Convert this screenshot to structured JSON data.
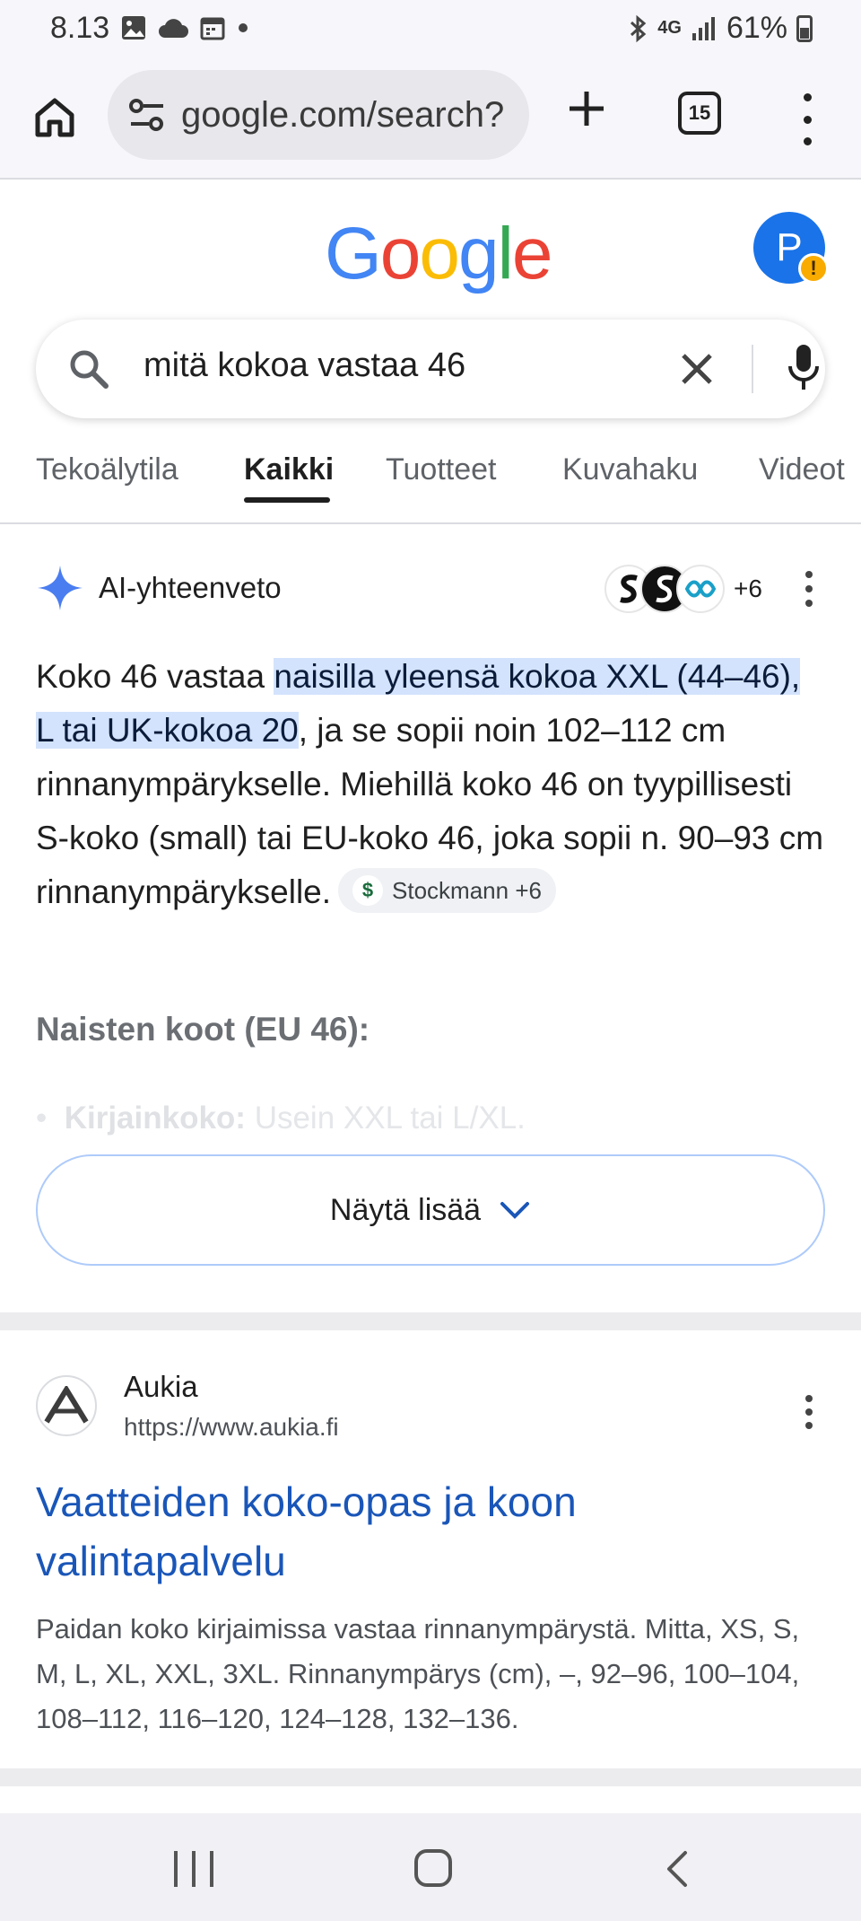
{
  "status_bar": {
    "time": "8.13",
    "network": "4G",
    "battery": "61%",
    "icons": [
      "image-icon",
      "cloud-icon",
      "calendar-icon",
      "dot-icon",
      "bluetooth-icon",
      "signal-icon",
      "battery-icon"
    ]
  },
  "browser": {
    "url": "google.com/search?",
    "tab_count": "15"
  },
  "google": {
    "logo_text": [
      "G",
      "o",
      "o",
      "g",
      "l",
      "e"
    ],
    "logo_colors": [
      "#4285F4",
      "#EA4335",
      "#FBBC05",
      "#4285F4",
      "#34A853",
      "#EA4335"
    ],
    "avatar_letter": "P",
    "avatar_badge": "!"
  },
  "search": {
    "query": "mitä kokoa vastaa 46"
  },
  "tabs": [
    {
      "label": "Tekoälytila",
      "active": false
    },
    {
      "label": "Kaikki",
      "active": true
    },
    {
      "label": "Tuotteet",
      "active": false
    },
    {
      "label": "Kuvahaku",
      "active": false
    },
    {
      "label": "Videot",
      "active": false
    }
  ],
  "ai_overview": {
    "title": "AI-yhteenveto",
    "sources_more": "+6",
    "text_before": "Koko 46 vastaa ",
    "text_highlight": "naisilla yleensä kokoa XXL (44–46), L tai UK-kokoa 20",
    "text_after": ", ja se sopii noin 102–112 cm rinnanympärykselle. Miehillä koko 46 on tyypillisesti S-koko (small) tai EU-koko 46, joka sopii n. 90–93 cm rinnanympärykselle.",
    "chip_label": "Stockmann +6",
    "subheading": "Naisten koot (EU 46):",
    "faded_bullet_label": "Kirjainkoko:",
    "faded_bullet_text": " Usein XXL tai L/XL.",
    "show_more_label": "Näytä lisää"
  },
  "result": {
    "site_name": "Aukia",
    "url": "https://www.aukia.fi",
    "title": "Vaatteiden koko-opas ja koon valintapalvelu",
    "snippet": "Paidan koko kirjaimissa vastaa rinnanympärystä. Mitta, XS, S, M, L, XL, XXL, 3XL. Rinnanympärys (cm), –, 92–96, 100–104, 108–112, 116–120, 124–128, 132–136."
  }
}
